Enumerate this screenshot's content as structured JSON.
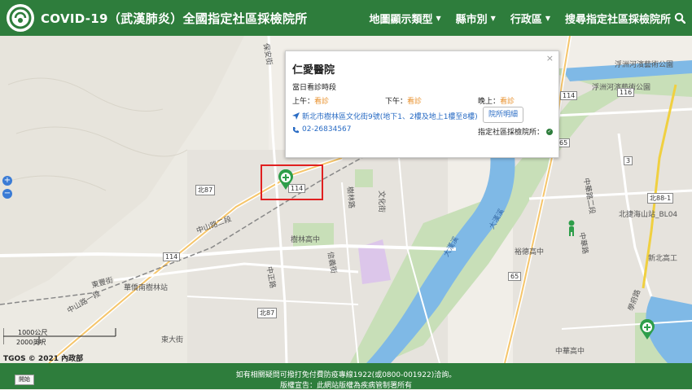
{
  "header": {
    "title": "COVID-19（武漢肺炎）全國指定社區採檢院所",
    "nav": [
      {
        "label": "地圖顯示類型"
      },
      {
        "label": "縣市別"
      },
      {
        "label": "行政區"
      },
      {
        "label": "搜尋指定社區採檢院所"
      }
    ]
  },
  "popup": {
    "name": "仁愛醫院",
    "hours_heading": "當日看診時段",
    "morning_label": "上午：",
    "morning_value": "看診",
    "afternoon_label": "下午：",
    "afternoon_value": "看診",
    "evening_label": "晚上：",
    "evening_value": "看診",
    "address": "新北市樹林區文化街9號(地下1、2樓及地上1樓至8樓)",
    "detail_button": "院所明細",
    "phone": "02-26834567",
    "designated_label": "指定社區採檢院所："
  },
  "map": {
    "labels": [
      {
        "text": "樹林高中"
      },
      {
        "text": "中正路"
      },
      {
        "text": "中山路二段"
      },
      {
        "text": "中山路一段"
      },
      {
        "text": "東豐街"
      },
      {
        "text": "東大街"
      },
      {
        "text": "大漢溪"
      },
      {
        "text": "大漢溪"
      },
      {
        "text": "浮洲河濱藝術公園"
      },
      {
        "text": "浮洲河濱藝術公園"
      },
      {
        "text": "新北高工"
      },
      {
        "text": "中華高中"
      },
      {
        "text": "裕德高中"
      },
      {
        "text": "北捷海山站_BL04"
      },
      {
        "text": "華僑南樹林站"
      },
      {
        "text": "學府路"
      },
      {
        "text": "中華路"
      },
      {
        "text": "保安街"
      },
      {
        "text": "文化街"
      },
      {
        "text": "信義街"
      },
      {
        "text": "中華路二段"
      },
      {
        "text": "樹林路"
      }
    ],
    "shields": [
      "114",
      "114",
      "北87",
      "116",
      "北88-1",
      "114",
      "北87",
      "3",
      "65",
      "65"
    ],
    "scale_metric": "1000公尺",
    "scale_imperial": "2000英呎",
    "copyright": "TGOS © 2021 內政部"
  },
  "zoom": {
    "in": "+",
    "out": "−"
  },
  "footer": {
    "line1": "如有相關疑問可撥打免付費防疫專線1922(或0800-001922)洽詢。",
    "line2": "版權宣告：此網站版權為疾病管制署所有",
    "start_button": "開始"
  },
  "colors": {
    "header_bg": "#2e7d3c",
    "accent_orange": "#e8912d",
    "link_blue": "#2a6cc4",
    "river": "#7fb9e6",
    "park": "#c8dfb8",
    "highlight_red": "#e02020"
  }
}
